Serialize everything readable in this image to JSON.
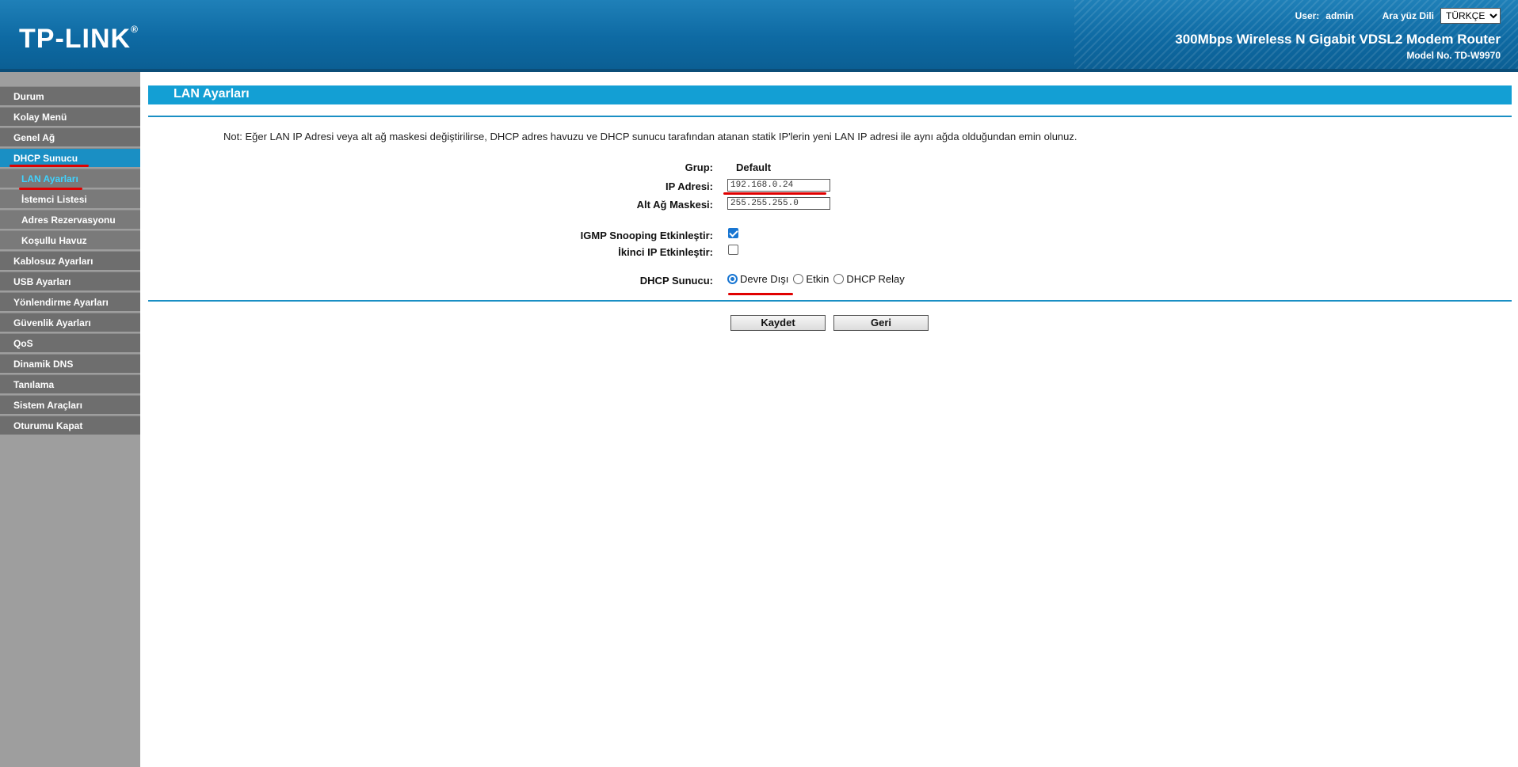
{
  "header": {
    "logo": "TP-LINK",
    "logo_mark": "®",
    "user_label": "User:",
    "user_value": "admin",
    "language_label": "Ara yüz Dili",
    "language_selected": "TÜRKÇE",
    "product": "300Mbps Wireless N Gigabit VDSL2 Modem Router",
    "model": "Model No. TD-W9970"
  },
  "sidebar": {
    "items": [
      {
        "label": "Durum"
      },
      {
        "label": "Kolay Menü"
      },
      {
        "label": "Genel Ağ"
      },
      {
        "label": "DHCP Sunucu"
      },
      {
        "label": "LAN Ayarları"
      },
      {
        "label": "İstemci Listesi"
      },
      {
        "label": "Adres Rezervasyonu"
      },
      {
        "label": "Koşullu Havuz"
      },
      {
        "label": "Kablosuz Ayarları"
      },
      {
        "label": "USB Ayarları"
      },
      {
        "label": "Yönlendirme Ayarları"
      },
      {
        "label": "Güvenlik Ayarları"
      },
      {
        "label": "QoS"
      },
      {
        "label": "Dinamik DNS"
      },
      {
        "label": "Tanılama"
      },
      {
        "label": "Sistem Araçları"
      },
      {
        "label": "Oturumu Kapat"
      }
    ]
  },
  "main": {
    "title": "LAN Ayarları",
    "note": "Not: Eğer LAN IP Adresi veya alt ağ maskesi değiştirilirse, DHCP adres havuzu ve DHCP sunucu tarafından atanan statik IP'lerin yeni LAN IP adresi ile aynı ağda olduğundan emin olunuz.",
    "group_label": "Grup:",
    "group_value": "Default",
    "ip_label": "IP Adresi:",
    "ip_value": "192.168.0.24",
    "mask_label": "Alt Ağ Maskesi:",
    "mask_value": "255.255.255.0",
    "igmp_label": "IGMP Snooping Etkinleştir:",
    "igmp_checked": true,
    "second_ip_label": "İkinci IP Etkinleştir:",
    "second_ip_checked": false,
    "dhcp_label": "DHCP Sunucu:",
    "dhcp_options": [
      "Devre Dışı",
      "Etkin",
      "DHCP Relay"
    ],
    "dhcp_selected": "Devre Dışı",
    "save_label": "Kaydet",
    "back_label": "Geri"
  },
  "colors": {
    "header": "#0e6aa3",
    "accent": "#139fd4",
    "sidebar_bg": "#9e9e9e",
    "menu_item": "#6e6e6e",
    "annotation": "#e00000"
  }
}
